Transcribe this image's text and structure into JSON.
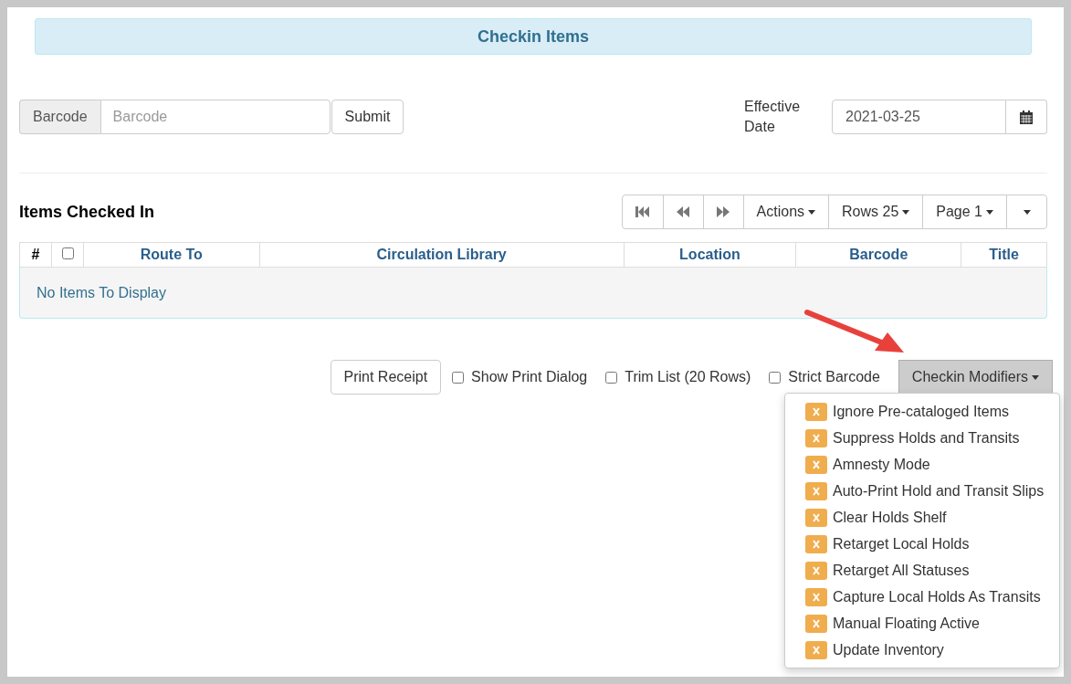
{
  "header": {
    "title": "Checkin Items"
  },
  "barcode_form": {
    "addon": "Barcode",
    "placeholder": "Barcode",
    "submit": "Submit"
  },
  "effective_date": {
    "label": "Effective Date",
    "value": "2021-03-25"
  },
  "items": {
    "title": "Items Checked In",
    "toolbar": [
      {
        "kind": "first"
      },
      {
        "kind": "prev"
      },
      {
        "kind": "next"
      },
      {
        "kind": "menu",
        "label": "Actions"
      },
      {
        "kind": "menu",
        "label": "Rows 25"
      },
      {
        "kind": "menu",
        "label": "Page 1"
      },
      {
        "kind": "menu"
      }
    ],
    "columns": [
      {
        "kind": "index",
        "label": "#"
      },
      {
        "kind": "select",
        "checked": false
      },
      {
        "kind": "text",
        "label": "Route To"
      },
      {
        "kind": "text",
        "label": "Circulation Library"
      },
      {
        "kind": "text",
        "label": "Location"
      },
      {
        "kind": "text",
        "label": "Barcode"
      },
      {
        "kind": "text",
        "label": "Title"
      }
    ],
    "empty_message": "No Items To Display"
  },
  "footer": {
    "print_button": "Print Receipt",
    "options": [
      {
        "label": "Show Print Dialog",
        "checked": false
      },
      {
        "label": "Trim List (20 Rows)",
        "checked": false
      },
      {
        "label": "Strict Barcode",
        "checked": false
      }
    ],
    "modifiers_button": "Checkin Modifiers",
    "modifiers": [
      {
        "label": "Ignore Pre-cataloged Items",
        "checked": false
      },
      {
        "label": "Suppress Holds and Transits",
        "checked": false
      },
      {
        "label": "Amnesty Mode",
        "checked": false
      },
      {
        "label": "Auto-Print Hold and Transit Slips",
        "checked": false
      },
      {
        "label": "Clear Holds Shelf",
        "checked": false
      },
      {
        "label": "Retarget Local Holds",
        "checked": false
      },
      {
        "label": "Retarget All Statuses",
        "checked": false
      },
      {
        "label": "Capture Local Holds As Transits",
        "checked": false
      },
      {
        "label": "Manual Floating Active",
        "checked": false
      },
      {
        "label": "Update Inventory",
        "checked": false
      }
    ]
  }
}
